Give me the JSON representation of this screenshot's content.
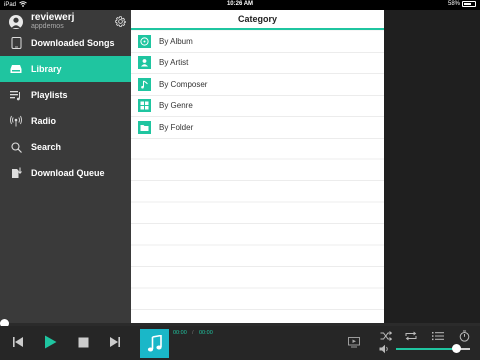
{
  "status_bar": {
    "device": "iPad",
    "time": "10:26 AM",
    "battery_text": "58%",
    "battery_level": 0.58
  },
  "profile": {
    "username": "reviewerj",
    "subtitle": "appdemos"
  },
  "sidebar": {
    "items": [
      {
        "label": "Downloaded Songs",
        "icon": "tablet-icon",
        "active": false
      },
      {
        "label": "Library",
        "icon": "drive-icon",
        "active": true
      },
      {
        "label": "Playlists",
        "icon": "playlist-icon",
        "active": false
      },
      {
        "label": "Radio",
        "icon": "radio-icon",
        "active": false
      },
      {
        "label": "Search",
        "icon": "search-icon",
        "active": false
      },
      {
        "label": "Download Queue",
        "icon": "download-queue-icon",
        "active": false
      }
    ]
  },
  "main": {
    "title": "Category",
    "categories": [
      {
        "label": "By Album",
        "icon": "album-icon"
      },
      {
        "label": "By Artist",
        "icon": "artist-icon"
      },
      {
        "label": "By Composer",
        "icon": "composer-icon"
      },
      {
        "label": "By Genre",
        "icon": "genre-icon"
      },
      {
        "label": "By Folder",
        "icon": "folder-icon"
      }
    ]
  },
  "player": {
    "elapsed": "00:00",
    "separator": "/",
    "duration": "00:00",
    "progress": 0,
    "volume": 0.82
  },
  "colors": {
    "accent": "#1fc5a0",
    "sidebar": "#3a3a3a",
    "player": "#262626",
    "album_art": "#1ab7c8"
  }
}
